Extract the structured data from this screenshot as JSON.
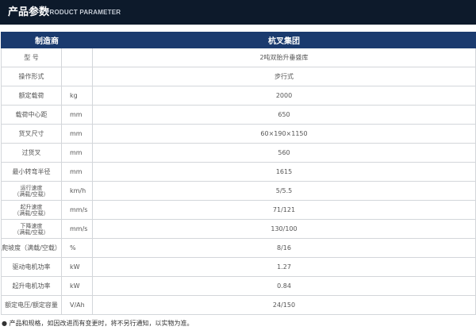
{
  "header": {
    "title": "产品参数",
    "subtitle": "PRODUCT PARAMETER"
  },
  "table": {
    "head_name": "制造商",
    "head_value": "杭叉集团",
    "rows": [
      {
        "name": "型 号",
        "unit": "",
        "value": "2吨双胎升垂盛库"
      },
      {
        "name": "操作形式",
        "unit": "",
        "value": "步行式"
      },
      {
        "name": "额定载荷",
        "unit": "kg",
        "value": "2000"
      },
      {
        "name": "载荷中心距",
        "unit": "mm",
        "value": "650"
      },
      {
        "name": "货叉尺寸",
        "unit": "mm",
        "value": "60×190×1150"
      },
      {
        "name": "过货叉",
        "unit": "mm",
        "value": "560"
      },
      {
        "name": "最小转弯半径",
        "unit": "mm",
        "value": "1615"
      },
      {
        "name_line1": "运行速度",
        "name_line2": "（满载/空载）",
        "unit": "km/h",
        "value": "5/5.5"
      },
      {
        "name_line1": "起升速度",
        "name_line2": "（满载/空载）",
        "unit": "mm/s",
        "value": "71/121"
      },
      {
        "name_line1": "下降速度",
        "name_line2": "（满载/空载）",
        "unit": "mm/s",
        "value": "130/100"
      },
      {
        "name": "爬坡度（满载/空载）",
        "unit": "%",
        "value": "8/16"
      },
      {
        "name": "驱动电机功率",
        "unit": "kW",
        "value": "1.27"
      },
      {
        "name": "起升电机功率",
        "unit": "kW",
        "value": "0.84"
      },
      {
        "name": "额定电压/额定容量",
        "unit": "V/Ah",
        "value": "24/150"
      }
    ]
  },
  "footnote": "● 产品和规格，如因改进而有变更时，将不另行通知，以实物为准。",
  "colors": {
    "banner": "#0d1a2b",
    "table_header": "#1a3a6e",
    "border": "#d3d6da"
  }
}
